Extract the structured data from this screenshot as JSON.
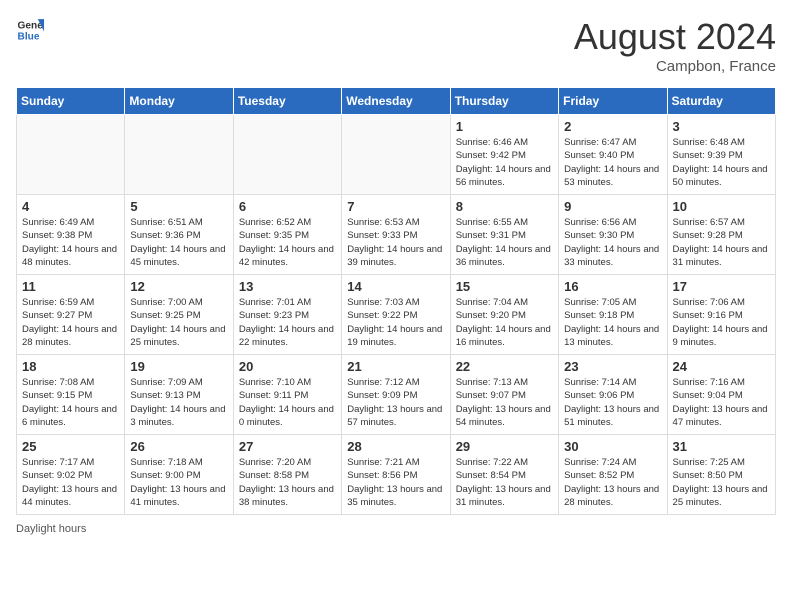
{
  "header": {
    "logo_general": "General",
    "logo_blue": "Blue",
    "month_year": "August 2024",
    "location": "Campbon, France"
  },
  "days_of_week": [
    "Sunday",
    "Monday",
    "Tuesday",
    "Wednesday",
    "Thursday",
    "Friday",
    "Saturday"
  ],
  "footer": {
    "label": "Daylight hours"
  },
  "weeks": [
    {
      "cells": [
        {
          "date": "",
          "info": ""
        },
        {
          "date": "",
          "info": ""
        },
        {
          "date": "",
          "info": ""
        },
        {
          "date": "",
          "info": ""
        },
        {
          "date": "1",
          "info": "Sunrise: 6:46 AM\nSunset: 9:42 PM\nDaylight: 14 hours and 56 minutes."
        },
        {
          "date": "2",
          "info": "Sunrise: 6:47 AM\nSunset: 9:40 PM\nDaylight: 14 hours and 53 minutes."
        },
        {
          "date": "3",
          "info": "Sunrise: 6:48 AM\nSunset: 9:39 PM\nDaylight: 14 hours and 50 minutes."
        }
      ]
    },
    {
      "cells": [
        {
          "date": "4",
          "info": "Sunrise: 6:49 AM\nSunset: 9:38 PM\nDaylight: 14 hours and 48 minutes."
        },
        {
          "date": "5",
          "info": "Sunrise: 6:51 AM\nSunset: 9:36 PM\nDaylight: 14 hours and 45 minutes."
        },
        {
          "date": "6",
          "info": "Sunrise: 6:52 AM\nSunset: 9:35 PM\nDaylight: 14 hours and 42 minutes."
        },
        {
          "date": "7",
          "info": "Sunrise: 6:53 AM\nSunset: 9:33 PM\nDaylight: 14 hours and 39 minutes."
        },
        {
          "date": "8",
          "info": "Sunrise: 6:55 AM\nSunset: 9:31 PM\nDaylight: 14 hours and 36 minutes."
        },
        {
          "date": "9",
          "info": "Sunrise: 6:56 AM\nSunset: 9:30 PM\nDaylight: 14 hours and 33 minutes."
        },
        {
          "date": "10",
          "info": "Sunrise: 6:57 AM\nSunset: 9:28 PM\nDaylight: 14 hours and 31 minutes."
        }
      ]
    },
    {
      "cells": [
        {
          "date": "11",
          "info": "Sunrise: 6:59 AM\nSunset: 9:27 PM\nDaylight: 14 hours and 28 minutes."
        },
        {
          "date": "12",
          "info": "Sunrise: 7:00 AM\nSunset: 9:25 PM\nDaylight: 14 hours and 25 minutes."
        },
        {
          "date": "13",
          "info": "Sunrise: 7:01 AM\nSunset: 9:23 PM\nDaylight: 14 hours and 22 minutes."
        },
        {
          "date": "14",
          "info": "Sunrise: 7:03 AM\nSunset: 9:22 PM\nDaylight: 14 hours and 19 minutes."
        },
        {
          "date": "15",
          "info": "Sunrise: 7:04 AM\nSunset: 9:20 PM\nDaylight: 14 hours and 16 minutes."
        },
        {
          "date": "16",
          "info": "Sunrise: 7:05 AM\nSunset: 9:18 PM\nDaylight: 14 hours and 13 minutes."
        },
        {
          "date": "17",
          "info": "Sunrise: 7:06 AM\nSunset: 9:16 PM\nDaylight: 14 hours and 9 minutes."
        }
      ]
    },
    {
      "cells": [
        {
          "date": "18",
          "info": "Sunrise: 7:08 AM\nSunset: 9:15 PM\nDaylight: 14 hours and 6 minutes."
        },
        {
          "date": "19",
          "info": "Sunrise: 7:09 AM\nSunset: 9:13 PM\nDaylight: 14 hours and 3 minutes."
        },
        {
          "date": "20",
          "info": "Sunrise: 7:10 AM\nSunset: 9:11 PM\nDaylight: 14 hours and 0 minutes."
        },
        {
          "date": "21",
          "info": "Sunrise: 7:12 AM\nSunset: 9:09 PM\nDaylight: 13 hours and 57 minutes."
        },
        {
          "date": "22",
          "info": "Sunrise: 7:13 AM\nSunset: 9:07 PM\nDaylight: 13 hours and 54 minutes."
        },
        {
          "date": "23",
          "info": "Sunrise: 7:14 AM\nSunset: 9:06 PM\nDaylight: 13 hours and 51 minutes."
        },
        {
          "date": "24",
          "info": "Sunrise: 7:16 AM\nSunset: 9:04 PM\nDaylight: 13 hours and 47 minutes."
        }
      ]
    },
    {
      "cells": [
        {
          "date": "25",
          "info": "Sunrise: 7:17 AM\nSunset: 9:02 PM\nDaylight: 13 hours and 44 minutes."
        },
        {
          "date": "26",
          "info": "Sunrise: 7:18 AM\nSunset: 9:00 PM\nDaylight: 13 hours and 41 minutes."
        },
        {
          "date": "27",
          "info": "Sunrise: 7:20 AM\nSunset: 8:58 PM\nDaylight: 13 hours and 38 minutes."
        },
        {
          "date": "28",
          "info": "Sunrise: 7:21 AM\nSunset: 8:56 PM\nDaylight: 13 hours and 35 minutes."
        },
        {
          "date": "29",
          "info": "Sunrise: 7:22 AM\nSunset: 8:54 PM\nDaylight: 13 hours and 31 minutes."
        },
        {
          "date": "30",
          "info": "Sunrise: 7:24 AM\nSunset: 8:52 PM\nDaylight: 13 hours and 28 minutes."
        },
        {
          "date": "31",
          "info": "Sunrise: 7:25 AM\nSunset: 8:50 PM\nDaylight: 13 hours and 25 minutes."
        }
      ]
    }
  ]
}
